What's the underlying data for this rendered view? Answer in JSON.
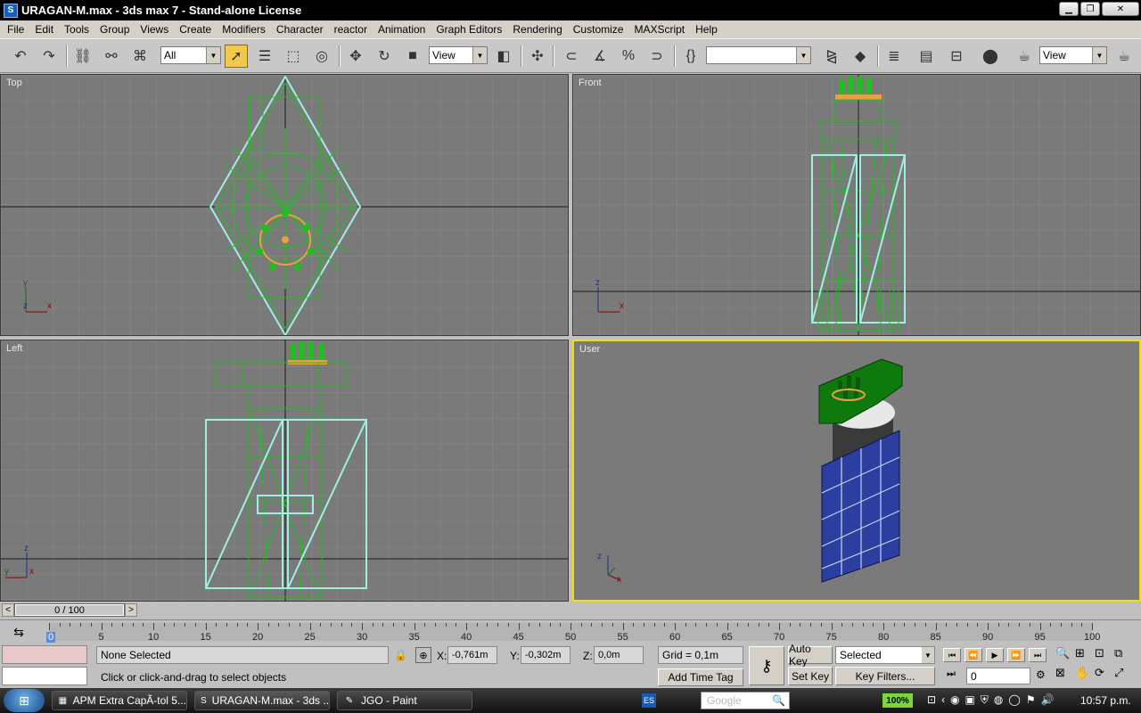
{
  "window": {
    "title": "URAGAN-M.max - 3ds max 7  - Stand-alone License",
    "minimize_glyph": "▁",
    "restore_glyph": "❐",
    "close_glyph": "✕"
  },
  "menu": [
    "File",
    "Edit",
    "Tools",
    "Group",
    "Views",
    "Create",
    "Modifiers",
    "Character",
    "reactor",
    "Animation",
    "Graph Editors",
    "Rendering",
    "Customize",
    "MAXScript",
    "Help"
  ],
  "toolbar": {
    "selection_filter": "All",
    "ref_coord": "View",
    "named_selection": "",
    "render_view": "View"
  },
  "viewports": {
    "top": {
      "label": "Top"
    },
    "front": {
      "label": "Front"
    },
    "left": {
      "label": "Left"
    },
    "user": {
      "label": "User"
    },
    "axis_labels": {
      "x": "x",
      "y": "y",
      "z": "z"
    }
  },
  "timeslider": {
    "position": "0 / 100",
    "prev": "<",
    "next": ">"
  },
  "trackbar": {
    "ticks": [
      "0",
      "5",
      "10",
      "15",
      "20",
      "25",
      "30",
      "35",
      "40",
      "45",
      "50",
      "55",
      "60",
      "65",
      "70",
      "75",
      "80",
      "85",
      "90",
      "95",
      "100"
    ]
  },
  "status": {
    "selection": "None Selected",
    "prompt": "Click or click-and-drag to select objects",
    "x_label": "X:",
    "x_value": "-0,761m",
    "y_label": "Y:",
    "y_value": "-0,302m",
    "z_label": "Z:",
    "z_value": "0,0m",
    "grid": "Grid = 0,1m",
    "add_time_tag": "Add Time Tag",
    "auto_key": "Auto Key",
    "set_key": "Set Key",
    "key_mode": "Selected",
    "key_filters": "Key Filters...",
    "current_frame": "0"
  },
  "taskbar": {
    "tasks": [
      {
        "label": "APM Extra CapÃ-tol 5..."
      },
      {
        "label": "URAGAN-M.max - 3ds ..."
      },
      {
        "label": "JGO - Paint"
      }
    ],
    "language": "ES",
    "search_placeholder": "Google",
    "zoom": "100%",
    "clock": "10:57 p.m."
  },
  "colors": {
    "viewport_bg": "#7a7a7a",
    "wire_green": "#1fbf1f",
    "wire_cyan": "#9ff0e0",
    "active_border": "#f4e000",
    "solar_blue": "#2a3fa0"
  }
}
